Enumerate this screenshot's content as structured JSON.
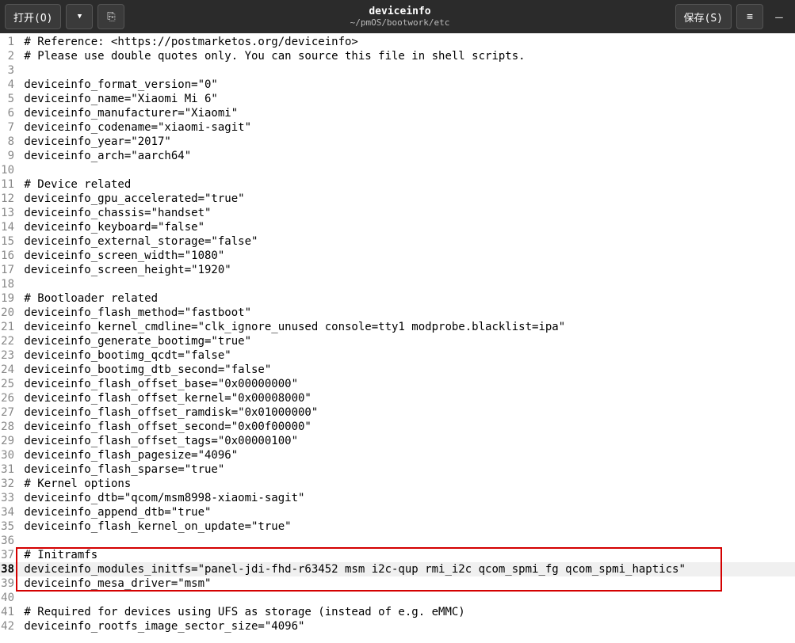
{
  "titlebar": {
    "open_label": "打开(O)",
    "save_label": "保存(S)",
    "title": "deviceinfo",
    "subtitle": "~/pmOS/bootwork/etc"
  },
  "icons": {
    "chevron_down": "▼",
    "new_tab": "⎘",
    "hamburger": "≡",
    "minimize": "—"
  },
  "lines": [
    {
      "n": 1,
      "t": "# Reference: <https://postmarketos.org/deviceinfo>"
    },
    {
      "n": 2,
      "t": "# Please use double quotes only. You can source this file in shell scripts."
    },
    {
      "n": 3,
      "t": ""
    },
    {
      "n": 4,
      "t": "deviceinfo_format_version=\"0\""
    },
    {
      "n": 5,
      "t": "deviceinfo_name=\"Xiaomi Mi 6\""
    },
    {
      "n": 6,
      "t": "deviceinfo_manufacturer=\"Xiaomi\""
    },
    {
      "n": 7,
      "t": "deviceinfo_codename=\"xiaomi-sagit\""
    },
    {
      "n": 8,
      "t": "deviceinfo_year=\"2017\""
    },
    {
      "n": 9,
      "t": "deviceinfo_arch=\"aarch64\""
    },
    {
      "n": 10,
      "t": ""
    },
    {
      "n": 11,
      "t": "# Device related"
    },
    {
      "n": 12,
      "t": "deviceinfo_gpu_accelerated=\"true\""
    },
    {
      "n": 13,
      "t": "deviceinfo_chassis=\"handset\""
    },
    {
      "n": 14,
      "t": "deviceinfo_keyboard=\"false\""
    },
    {
      "n": 15,
      "t": "deviceinfo_external_storage=\"false\""
    },
    {
      "n": 16,
      "t": "deviceinfo_screen_width=\"1080\""
    },
    {
      "n": 17,
      "t": "deviceinfo_screen_height=\"1920\""
    },
    {
      "n": 18,
      "t": ""
    },
    {
      "n": 19,
      "t": "# Bootloader related"
    },
    {
      "n": 20,
      "t": "deviceinfo_flash_method=\"fastboot\""
    },
    {
      "n": 21,
      "t": "deviceinfo_kernel_cmdline=\"clk_ignore_unused console=tty1 modprobe.blacklist=ipa\""
    },
    {
      "n": 22,
      "t": "deviceinfo_generate_bootimg=\"true\""
    },
    {
      "n": 23,
      "t": "deviceinfo_bootimg_qcdt=\"false\""
    },
    {
      "n": 24,
      "t": "deviceinfo_bootimg_dtb_second=\"false\""
    },
    {
      "n": 25,
      "t": "deviceinfo_flash_offset_base=\"0x00000000\""
    },
    {
      "n": 26,
      "t": "deviceinfo_flash_offset_kernel=\"0x00008000\""
    },
    {
      "n": 27,
      "t": "deviceinfo_flash_offset_ramdisk=\"0x01000000\""
    },
    {
      "n": 28,
      "t": "deviceinfo_flash_offset_second=\"0x00f00000\""
    },
    {
      "n": 29,
      "t": "deviceinfo_flash_offset_tags=\"0x00000100\""
    },
    {
      "n": 30,
      "t": "deviceinfo_flash_pagesize=\"4096\""
    },
    {
      "n": 31,
      "t": "deviceinfo_flash_sparse=\"true\""
    },
    {
      "n": 32,
      "t": "# Kernel options"
    },
    {
      "n": 33,
      "t": "deviceinfo_dtb=\"qcom/msm8998-xiaomi-sagit\""
    },
    {
      "n": 34,
      "t": "deviceinfo_append_dtb=\"true\""
    },
    {
      "n": 35,
      "t": "deviceinfo_flash_kernel_on_update=\"true\""
    },
    {
      "n": 36,
      "t": ""
    },
    {
      "n": 37,
      "t": "# Initramfs"
    },
    {
      "n": 38,
      "t": "deviceinfo_modules_initfs=\"panel-jdi-fhd-r63452 msm i2c-qup rmi_i2c qcom_spmi_fg qcom_spmi_haptics\""
    },
    {
      "n": 39,
      "t": "deviceinfo_mesa_driver=\"msm\""
    },
    {
      "n": 40,
      "t": ""
    },
    {
      "n": 41,
      "t": "# Required for devices using UFS as storage (instead of e.g. eMMC)"
    },
    {
      "n": 42,
      "t": "deviceinfo_rootfs_image_sector_size=\"4096\""
    }
  ],
  "highlight_line": 38,
  "redbox": {
    "top_line": 37,
    "bottom_line": 39
  }
}
